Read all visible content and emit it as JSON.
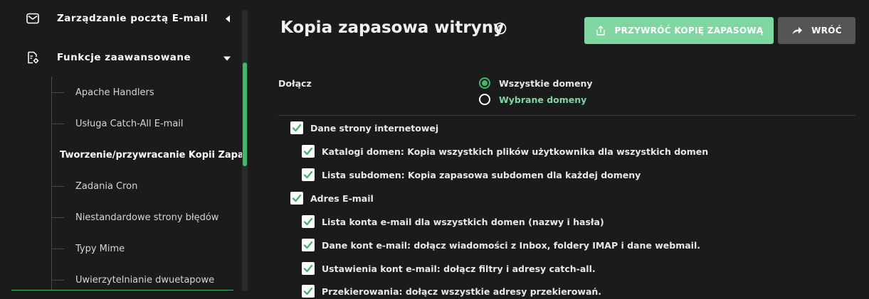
{
  "sidebar": {
    "menus": [
      {
        "label": "Zarządzanie pocztą E-mail"
      },
      {
        "label": "Funkcje zaawansowane"
      }
    ],
    "items": [
      {
        "label": "Apache Handlers"
      },
      {
        "label": "Usługa Catch-All E-mail"
      },
      {
        "label": "Tworzenie/przywracanie Kopii Zapasowej"
      },
      {
        "label": "Zadania Cron"
      },
      {
        "label": "Niestandardowe strony błędów"
      },
      {
        "label": "Typy Mime"
      },
      {
        "label": "Uwierzytelnianie dwuetapowe"
      }
    ]
  },
  "header": {
    "title": "Kopia zapasowa witryny",
    "restore_label": "PRZYWRÓĆ KOPIĘ ZAPASOWĄ",
    "back_label": "WRÓĆ"
  },
  "include": {
    "label": "Dołącz",
    "options": [
      {
        "label": "Wszystkie domeny",
        "selected": true
      },
      {
        "label": "Wybrane domeny",
        "selected": false
      }
    ]
  },
  "checkboxes": [
    {
      "label": "Dane strony internetowej",
      "checked": true
    },
    {
      "label": "Katalogi domen: Kopia wszystkich plików użytkownika dla wszystkich domen",
      "checked": true
    },
    {
      "label": "Lista subdomen: Kopia zapasowa subdomen dla każdej domeny",
      "checked": true
    },
    {
      "label": "Adres E-mail",
      "checked": true
    },
    {
      "label": "Lista konta e-mail dla wszystkich domen (nazwy i hasła)",
      "checked": true
    },
    {
      "label": "Dane kont e-mail: dołącz wiadomości z Inbox, foldery IMAP i dane webmail.",
      "checked": true
    },
    {
      "label": "Ustawienia kont e-mail: dołącz filtry i adresy catch-all.",
      "checked": true
    },
    {
      "label": "Przekierowania: dołącz wszystkie adresy przekierowań.",
      "checked": true
    }
  ],
  "colors": {
    "accent": "#3fb86b",
    "accent_light": "#7fd6a0",
    "background": "#1b1b1b",
    "back_button": "#555555"
  },
  "icons": {
    "email_menu": "envelope-icon",
    "advanced_menu": "document-gear-icon",
    "help": "question-circle-icon",
    "restore": "upload-box-icon",
    "back": "share-arrow-icon"
  }
}
